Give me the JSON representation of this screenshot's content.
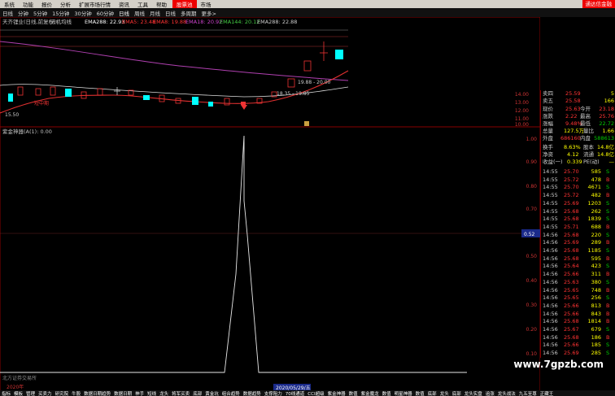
{
  "menu": {
    "items": [
      "系统",
      "功能",
      "报价",
      "分析",
      "扩展市场行情",
      "资讯",
      "工具",
      "帮助"
    ],
    "active": "股票池",
    "extra": "市场",
    "right": "通达信金融"
  },
  "periods": [
    "日线",
    "分钟",
    "5分钟",
    "15分钟",
    "30分钟",
    "60分钟",
    "日线",
    "周线",
    "月线",
    "日线",
    "多周期",
    "更多>"
  ],
  "main_chart": {
    "legend": "天齐锂业(日线,前复权)",
    "ema_items": [
      {
        "label": "天机均线",
        "color": "#cccccc"
      },
      {
        "label": "EMA288: 22.93",
        "color": "#ffffff"
      },
      {
        "label": "EMA5: 23.48",
        "color": "#ff3333"
      },
      {
        "label": "EMA8: 19.88",
        "color": "#ff3333"
      },
      {
        "label": "EMA18: 20.92",
        "color": "#cc44cc"
      },
      {
        "label": "EMA144: 20.12",
        "color": "#44cc44"
      },
      {
        "label": "EMA288: 22.88",
        "color": "#cccccc"
      }
    ],
    "low_label": "15.50",
    "zone_label_1": "18.35 - 19.85",
    "zone_label_2": "19.88 - 20.00",
    "small_label": "短中期",
    "right_ticks": [
      "14.00",
      "13.00",
      "12.00",
      "11.00",
      "10.00"
    ]
  },
  "indicator": {
    "legend": "紫金神器(A(1): 0.00",
    "ticks": [
      "1.00",
      "0.90",
      "0.80",
      "0.70",
      "0.60",
      "0.50",
      "0.40",
      "0.30",
      "0.20",
      "0.10"
    ],
    "cursor_value": "0.52",
    "date_left": "2020年",
    "date_center": "2020/05/29/五",
    "x_mark": "1"
  },
  "quote": {
    "sell1": {
      "label": "卖四",
      "price": "25.59",
      "vol": "5"
    },
    "buy1": {
      "label": "卖五",
      "price": "25.58",
      "vol": "166"
    },
    "rows": [
      {
        "l1": "现价",
        "v1": "25.63",
        "l2": "今开",
        "v2": "23.18"
      },
      {
        "l1": "涨跌",
        "v1": "2.22",
        "l2": "最高",
        "v2": "25.76"
      },
      {
        "l1": "涨幅",
        "v1": "9.48%",
        "l2": "最低",
        "v2": "22.72"
      },
      {
        "l1": "总量",
        "v1": "127.5万",
        "l2": "量比",
        "v2": "1.66"
      },
      {
        "l1": "外盘",
        "v1": "686160",
        "l2": "内盘",
        "v2": "588613"
      },
      {
        "l1": "换手",
        "v1": "8.63%",
        "l2": "股本",
        "v2": "14.8亿"
      },
      {
        "l1": "净资",
        "v1": "4.12",
        "l2": "流通",
        "v2": "14.8亿"
      },
      {
        "l1": "收益(一)",
        "v1": "0.339",
        "l2": "PE(动)",
        "v2": "—"
      }
    ],
    "ticks": [
      {
        "t": "14:55",
        "p": "25.70",
        "v": "585",
        "d": "S"
      },
      {
        "t": "14:55",
        "p": "25.72",
        "v": "478",
        "d": "B"
      },
      {
        "t": "14:55",
        "p": "25.70",
        "v": "4671",
        "d": "S"
      },
      {
        "t": "14:55",
        "p": "25.72",
        "v": "482",
        "d": "B"
      },
      {
        "t": "14:55",
        "p": "25.69",
        "v": "1203",
        "d": "S"
      },
      {
        "t": "14:55",
        "p": "25.68",
        "v": "262",
        "d": "S"
      },
      {
        "t": "14:55",
        "p": "25.68",
        "v": "1839",
        "d": "S"
      },
      {
        "t": "14:55",
        "p": "25.71",
        "v": "688",
        "d": "B"
      },
      {
        "t": "14:56",
        "p": "25.68",
        "v": "220",
        "d": "S"
      },
      {
        "t": "14:56",
        "p": "25.69",
        "v": "289",
        "d": "B"
      },
      {
        "t": "14:56",
        "p": "25.68",
        "v": "1185",
        "d": "S"
      },
      {
        "t": "14:56",
        "p": "25.68",
        "v": "595",
        "d": "B"
      },
      {
        "t": "14:56",
        "p": "25.64",
        "v": "423",
        "d": "S"
      },
      {
        "t": "14:56",
        "p": "25.66",
        "v": "311",
        "d": "B"
      },
      {
        "t": "14:56",
        "p": "25.63",
        "v": "380",
        "d": "S"
      },
      {
        "t": "14:56",
        "p": "25.65",
        "v": "748",
        "d": "B"
      },
      {
        "t": "14:56",
        "p": "25.65",
        "v": "256",
        "d": "S"
      },
      {
        "t": "14:56",
        "p": "25.66",
        "v": "813",
        "d": "B"
      },
      {
        "t": "14:56",
        "p": "25.66",
        "v": "843",
        "d": "B"
      },
      {
        "t": "14:56",
        "p": "25.68",
        "v": "1814",
        "d": "B"
      },
      {
        "t": "14:56",
        "p": "25.67",
        "v": "679",
        "d": "S"
      },
      {
        "t": "14:56",
        "p": "25.68",
        "v": "186",
        "d": "B"
      },
      {
        "t": "14:56",
        "p": "25.66",
        "v": "185",
        "d": "S"
      },
      {
        "t": "14:56",
        "p": "25.69",
        "v": "285",
        "d": "S"
      }
    ]
  },
  "bottom_tabs": [
    "指标",
    "模板",
    "管理",
    "买卖力",
    "研究院",
    "牛股",
    "数据日期趋势",
    "数据日期",
    "神手",
    "短线",
    "龙头",
    "将军买卖",
    "底部",
    "黄金坑",
    "组合趋势",
    "数据趋势",
    "支撑阻力",
    "70线通道",
    "CCI超级",
    "紫金神器",
    "数值",
    "紫金魔龙",
    "数值",
    "明星神器",
    "数值",
    "底部",
    "龙头",
    "底部",
    "龙头实盘",
    "追涨",
    "龙头战法",
    "九五至尊",
    "正藏王"
  ],
  "watermark": "www.7gpzb.com",
  "status_left": "北方证券交易所"
}
